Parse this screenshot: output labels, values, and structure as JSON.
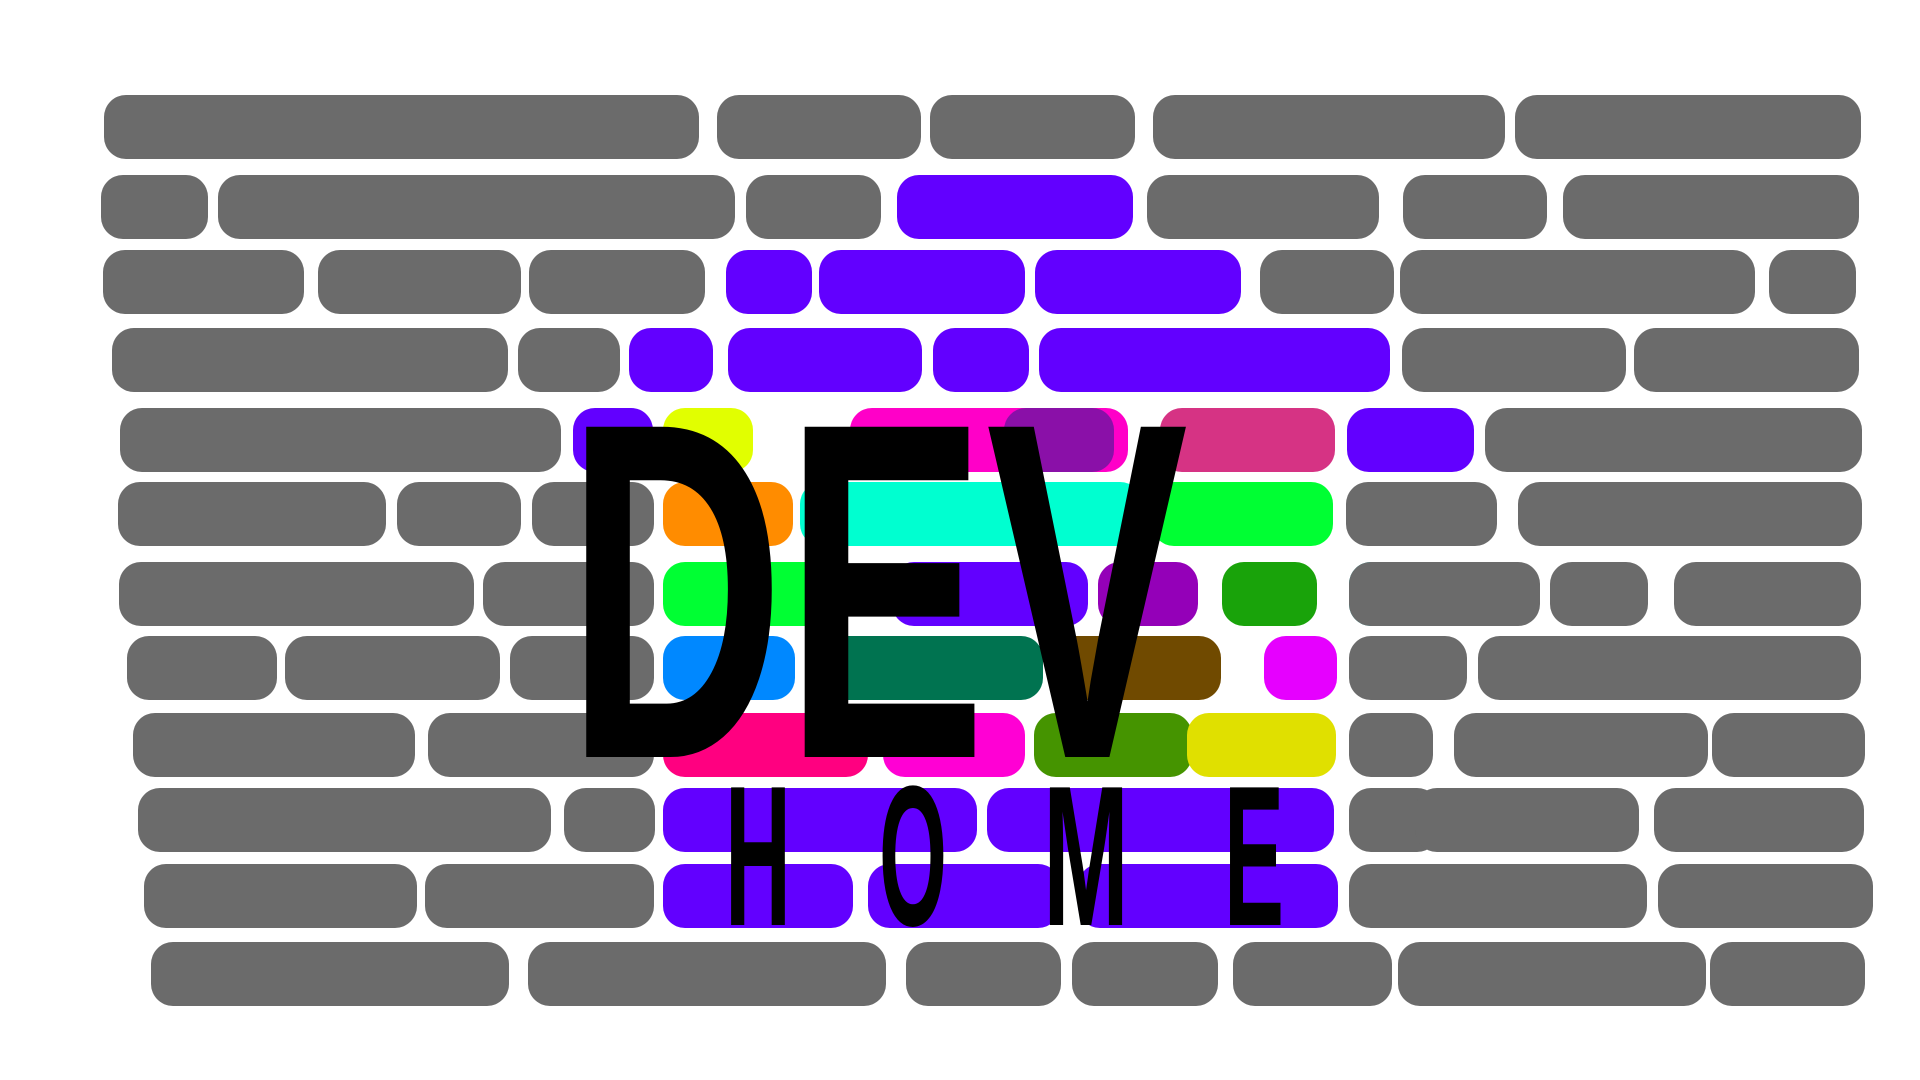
{
  "colors": {
    "background": "#ffffff",
    "bar_default": "#6b6b6b",
    "text": "#000000",
    "accent": "#6200ff"
  },
  "logo": {
    "title": "DEV",
    "letters": [
      "H",
      "O",
      "M",
      "E"
    ]
  },
  "rows": [
    [
      [
        "#6b6b6b"
      ],
      [
        "#6b6b6b"
      ],
      [
        "#6b6b6b"
      ],
      [
        "#6b6b6b"
      ],
      [
        "#6b6b6b"
      ]
    ],
    [
      [
        "#6b6b6b"
      ],
      [
        "#6b6b6b"
      ],
      [
        "#6b6b6b"
      ],
      [
        "#6200ff"
      ],
      [
        "#6b6b6b"
      ],
      [
        "#6b6b6b"
      ],
      [
        "#6b6b6b"
      ]
    ],
    [
      [
        "#6b6b6b"
      ],
      [
        "#6b6b6b"
      ],
      [
        "#6b6b6b"
      ],
      [
        "#6200ff"
      ],
      [
        "#6200ff"
      ],
      [
        "#6200ff"
      ],
      [
        "#6b6b6b"
      ],
      [
        "#6b6b6b"
      ],
      [
        "#6b6b6b"
      ]
    ],
    [
      [
        "#6b6b6b"
      ],
      [
        "#6b6b6b"
      ],
      [
        "#6200ff"
      ],
      [
        "#6200ff"
      ],
      [
        "#6200ff"
      ],
      [
        "#6200ff"
      ],
      [
        "#6b6b6b"
      ],
      [
        "#6b6b6b"
      ]
    ],
    [
      [
        "#6b6b6b"
      ],
      [
        "#6200ff"
      ],
      [
        "#e1ff00"
      ],
      [
        "#ff00c8"
      ],
      [
        "#8a10a8"
      ],
      [
        "#d63384"
      ],
      [
        "#6200ff"
      ],
      [
        "#6b6b6b"
      ]
    ],
    [
      [
        "#6b6b6b"
      ],
      [
        "#6b6b6b"
      ],
      [
        "#6b6b6b"
      ],
      [
        "#ff8c00"
      ],
      [
        "#00ffd0"
      ],
      [
        "#00ff33"
      ],
      [
        "#6b6b6b"
      ],
      [
        "#6b6b6b"
      ]
    ],
    [
      [
        "#6b6b6b"
      ],
      [
        "#6b6b6b"
      ],
      [
        "#00ff33"
      ],
      [
        "#6200ff"
      ],
      [
        "#9400b8"
      ],
      [
        "#19a30a"
      ],
      [
        "#00a3a3"
      ],
      [
        "#6b6b6b"
      ],
      [
        "#6b6b6b"
      ],
      [
        "#6b6b6b"
      ]
    ],
    [
      [
        "#6b6b6b"
      ],
      [
        "#6b6b6b"
      ],
      [
        "#6b6b6b"
      ],
      [
        "#0088ff"
      ],
      [
        "#007350"
      ],
      [
        "#704a00"
      ],
      [
        "#e600ff"
      ],
      [
        "#6b6b6b"
      ],
      [
        "#6b6b6b"
      ]
    ],
    [
      [
        "#6b6b6b"
      ],
      [
        "#6b6b6b"
      ],
      [
        "#ff0080"
      ],
      [
        "#ff00d4"
      ],
      [
        "#459400"
      ],
      [
        "#e0e000"
      ],
      [
        "#6b6b6b"
      ],
      [
        "#6b6b6b"
      ],
      [
        "#6b6b6b"
      ]
    ],
    [
      [
        "#6b6b6b"
      ],
      [
        "#6b6b6b"
      ],
      [
        "#6200ff"
      ],
      [
        "#6200ff"
      ],
      [
        "#6b6b6b"
      ],
      [
        "#6b6b6b"
      ],
      [
        "#6b6b6b"
      ]
    ],
    [
      [
        "#6b6b6b"
      ],
      [
        "#6b6b6b"
      ],
      [
        "#6200ff"
      ],
      [
        "#6200ff"
      ],
      [
        "#6200ff"
      ],
      [
        "#6b6b6b"
      ],
      [
        "#6b6b6b"
      ]
    ],
    [
      [
        "#6b6b6b"
      ],
      [
        "#6b6b6b"
      ],
      [
        "#6b6b6b"
      ],
      [
        "#6b6b6b"
      ],
      [
        "#6b6b6b"
      ],
      [
        "#6b6b6b"
      ],
      [
        "#6b6b6b"
      ]
    ]
  ]
}
